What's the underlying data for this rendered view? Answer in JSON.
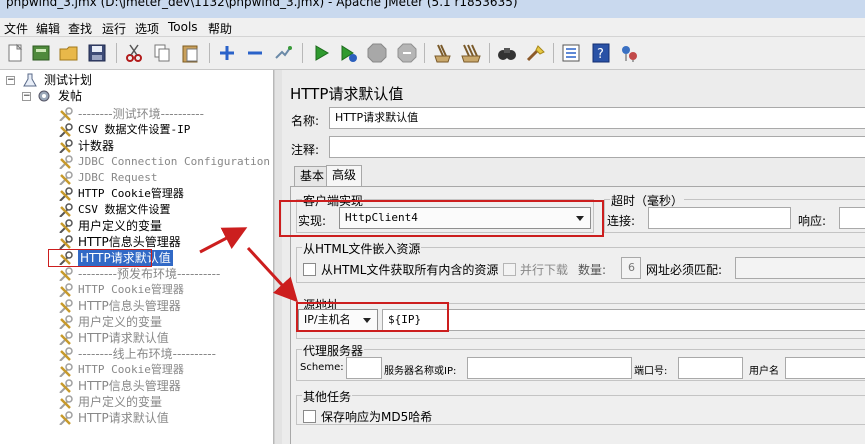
{
  "window": {
    "title": "phpwind_3.jmx (D:\\jmeter_dev\\1132\\phpwind_3.jmx) - Apache JMeter (5.1 r1853635)"
  },
  "menu": [
    "文件",
    "编辑",
    "查找",
    "运行",
    "选项",
    "Tools",
    "帮助"
  ],
  "toolbar_icons": [
    "new-icon",
    "templates-icon",
    "open-icon",
    "save-icon",
    "cut-icon",
    "copy-icon",
    "paste-icon",
    "expand-icon",
    "collapse-icon",
    "toggle-icon",
    "start-icon",
    "start-no-pause-icon",
    "stop-icon",
    "shutdown-icon",
    "clear-icon",
    "clear-all-icon",
    "search-icon",
    "reset-search-icon",
    "function-helper-icon",
    "help-icon",
    "remote-icon"
  ],
  "tree": {
    "root": "测试计划",
    "thread_group": "发帖",
    "items": [
      {
        "label": "--------测试环境----------",
        "mono": false,
        "disabled": true
      },
      {
        "label": "CSV 数据文件设置-IP",
        "mono": true,
        "disabled": false
      },
      {
        "label": "计数器",
        "mono": false,
        "disabled": false
      },
      {
        "label": "JDBC Connection Configuration",
        "mono": true,
        "disabled": true
      },
      {
        "label": "JDBC Request",
        "mono": true,
        "disabled": true
      },
      {
        "label": "HTTP Cookie管理器",
        "mono": true,
        "disabled": false
      },
      {
        "label": "CSV 数据文件设置",
        "mono": true,
        "disabled": false
      },
      {
        "label": "用户定义的变量",
        "mono": false,
        "disabled": false
      },
      {
        "label": "HTTP信息头管理器",
        "mono": false,
        "disabled": false
      },
      {
        "label": "HTTP请求默认值",
        "mono": false,
        "disabled": false,
        "selected": true
      },
      {
        "label": "---------预发布环境----------",
        "mono": false,
        "disabled": true
      },
      {
        "label": "HTTP Cookie管理器",
        "mono": true,
        "disabled": true
      },
      {
        "label": "HTTP信息头管理器",
        "mono": false,
        "disabled": true
      },
      {
        "label": "用户定义的变量",
        "mono": false,
        "disabled": true
      },
      {
        "label": "HTTP请求默认值",
        "mono": false,
        "disabled": true
      },
      {
        "label": "--------线上布环境----------",
        "mono": false,
        "disabled": true
      },
      {
        "label": "HTTP Cookie管理器",
        "mono": true,
        "disabled": true
      },
      {
        "label": "HTTP信息头管理器",
        "mono": false,
        "disabled": true
      },
      {
        "label": "用户定义的变量",
        "mono": false,
        "disabled": true
      },
      {
        "label": "HTTP请求默认值",
        "mono": false,
        "disabled": true
      }
    ]
  },
  "panel": {
    "title": "HTTP请求默认值",
    "name_label": "名称:",
    "name_value": "HTTP请求默认值",
    "comment_label": "注释:",
    "comment_value": "",
    "tabs": [
      "基本",
      "高级"
    ],
    "client_impl": {
      "legend": "客户端实现",
      "label": "实现:",
      "value": "HttpClient4"
    },
    "timeout": {
      "legend": "超时（毫秒）",
      "connect_label": "连接:",
      "connect_value": "",
      "response_label": "响应:",
      "response_value": ""
    },
    "embedded": {
      "legend": "从HTML文件嵌入资源",
      "retrieve_label": "从HTML文件获取所有内含的资源",
      "parallel_label": "并行下载",
      "count_label": "数量:",
      "count_value": "6",
      "match_label": "网址必须匹配:",
      "match_value": ""
    },
    "source": {
      "legend": "源地址",
      "type_value": "IP/主机名",
      "address_value": "${IP}"
    },
    "proxy": {
      "legend": "代理服务器",
      "scheme_label": "Scheme:",
      "host_label": "服务器名称或IP:",
      "port_label": "端口号:",
      "user_label": "用户名"
    },
    "other": {
      "legend": "其他任务",
      "md5_label": "保存响应为MD5哈希"
    }
  },
  "colors": {
    "annotation": "#cc1e1e",
    "selection_bg": "#3169c6"
  }
}
